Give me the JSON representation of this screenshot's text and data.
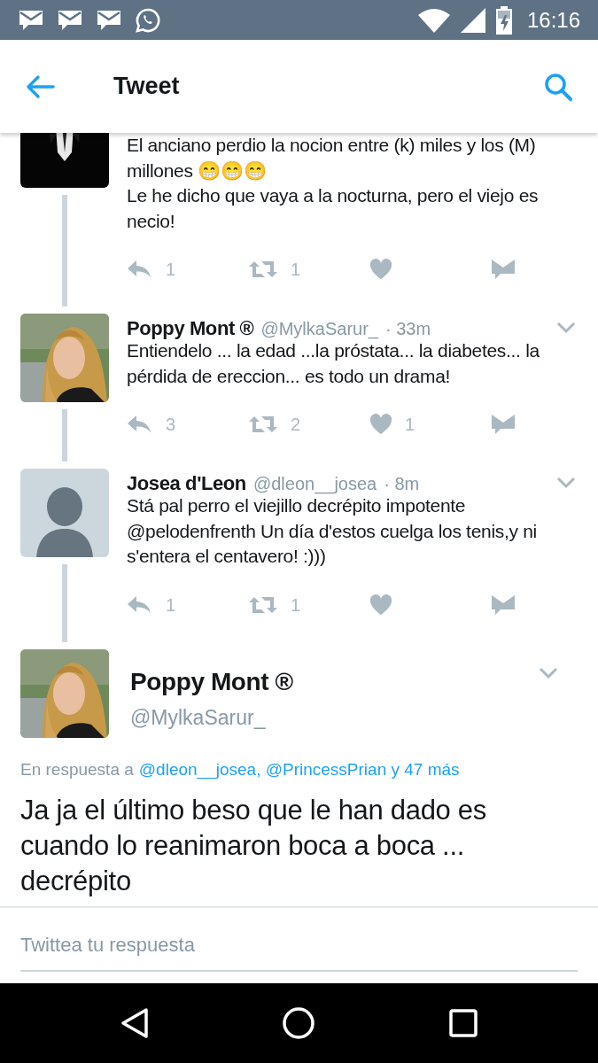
{
  "status_bar": {
    "time": "16:16"
  },
  "header": {
    "title": "Tweet"
  },
  "thread": [
    {
      "text": "El anciano perdio la nocion entre (k) miles y los (M) millones 😁😁😁\nLe he dicho que vaya a la nocturna, pero el viejo es necio!",
      "actions": [
        {
          "kind": "reply",
          "count": "1"
        },
        {
          "kind": "retweet",
          "count": "1"
        },
        {
          "kind": "like"
        },
        {
          "kind": "message"
        }
      ]
    },
    {
      "name": "Poppy Mont ®",
      "handle": "@MylkaSarur_",
      "time": "· 33m",
      "text": "Entiendelo ... la edad ...la próstata... la diabetes... la pérdida de ereccion... es todo un drama!",
      "actions": [
        {
          "kind": "reply",
          "count": "3"
        },
        {
          "kind": "retweet",
          "count": "2"
        },
        {
          "kind": "like",
          "count": "1"
        },
        {
          "kind": "message"
        }
      ]
    },
    {
      "avatar": {
        "kind": "default"
      },
      "name": "Josea d'Leon",
      "handle": "@dleon__josea",
      "time": "· 8m",
      "text": "Stá pal perro el viejillo decrépito impotente @pelodenfrenth Un día d'estos cuelga los tenis,y ni s'entera el centavero! :)))",
      "actions": [
        {
          "kind": "reply",
          "count": "1"
        },
        {
          "kind": "retweet",
          "count": "1"
        },
        {
          "kind": "like"
        },
        {
          "kind": "message"
        }
      ]
    }
  ],
  "main_tweet": {
    "name": "Poppy Mont ®",
    "handle": "@MylkaSarur_",
    "reply_prefix": "En respuesta a",
    "reply_to": "@dleon__josea, @PrincessPrian y 47 más",
    "text": "Ja ja el último beso que le han dado es cuando lo reanimaron boca a boca ... decrépito"
  },
  "reply_field": {
    "placeholder": "Twittea tu respuesta"
  }
}
